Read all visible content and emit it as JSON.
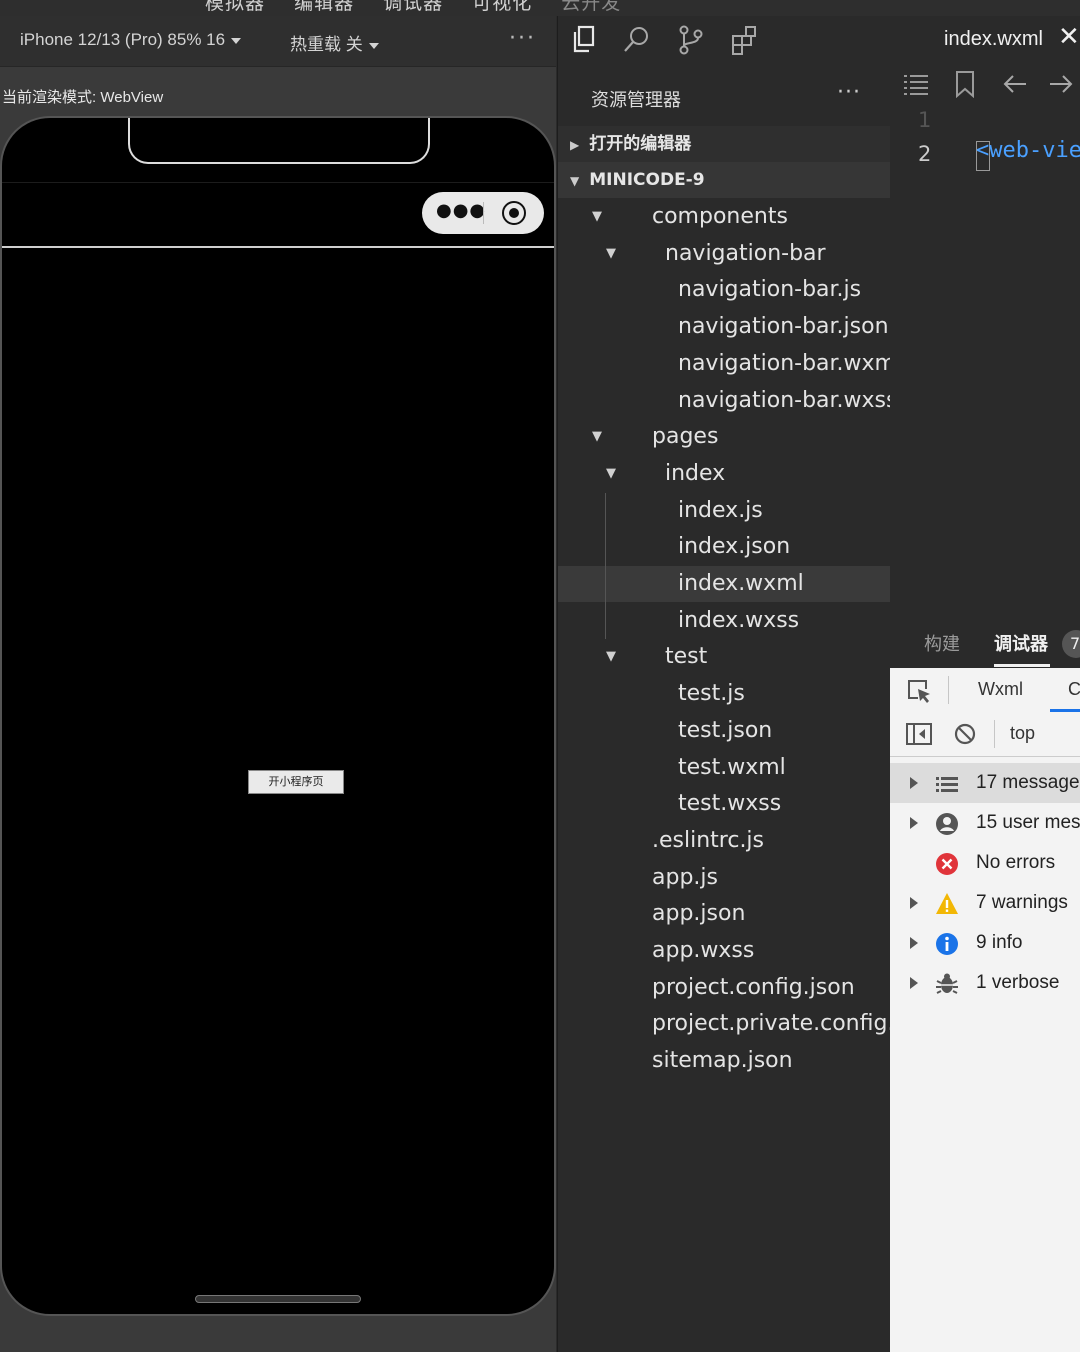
{
  "topbar": {
    "tabs": [
      "模拟器",
      "编辑器",
      "调试器",
      "可视化",
      "云开发"
    ]
  },
  "simulator": {
    "device_select": "iPhone 12/13 (Pro) 85% 16",
    "hot_reload": "热重载 关",
    "more": "···",
    "render_mode": "当前渲染模式: WebView",
    "open_button": "开小程序页"
  },
  "explorer": {
    "title": "资源管理器",
    "more": "···",
    "open_editors": "打开的编辑器",
    "project": "MINICODE-9",
    "tree": [
      {
        "label": "components",
        "twisty": "open"
      },
      {
        "label": "navigation-bar",
        "twisty": "open"
      },
      {
        "label": "navigation-bar.js",
        "twisty": ""
      },
      {
        "label": "navigation-bar.json",
        "twisty": ""
      },
      {
        "label": "navigation-bar.wxml",
        "twisty": ""
      },
      {
        "label": "navigation-bar.wxss",
        "twisty": ""
      },
      {
        "label": "pages",
        "twisty": "open"
      },
      {
        "label": "index",
        "twisty": "open"
      },
      {
        "label": "index.js",
        "twisty": ""
      },
      {
        "label": "index.json",
        "twisty": ""
      },
      {
        "label": "index.wxml",
        "twisty": "",
        "selected": true
      },
      {
        "label": "index.wxss",
        "twisty": ""
      },
      {
        "label": "test",
        "twisty": "open"
      },
      {
        "label": "test.js",
        "twisty": ""
      },
      {
        "label": "test.json",
        "twisty": ""
      },
      {
        "label": "test.wxml",
        "twisty": ""
      },
      {
        "label": "test.wxss",
        "twisty": ""
      },
      {
        "label": ".eslintrc.js",
        "twisty": ""
      },
      {
        "label": "app.js",
        "twisty": ""
      },
      {
        "label": "app.json",
        "twisty": ""
      },
      {
        "label": "app.wxss",
        "twisty": ""
      },
      {
        "label": "project.config.json",
        "twisty": ""
      },
      {
        "label": "project.private.config...",
        "twisty": ""
      },
      {
        "label": "sitemap.json",
        "twisty": ""
      }
    ]
  },
  "editor": {
    "tab_label": "index.wxml",
    "close": "✕",
    "line_numbers": [
      "1",
      "2"
    ],
    "code_line_2": "<web-vie"
  },
  "debugger": {
    "tabs": [
      "构建",
      "调试器"
    ],
    "badge": "7",
    "panel_tabs": [
      "Wxml",
      "C"
    ],
    "context": "top",
    "console_rows": [
      {
        "icon": "list-icon",
        "text": "17 message",
        "expandable": true
      },
      {
        "icon": "user-icon",
        "text": "15 user mes",
        "expandable": true
      },
      {
        "icon": "error-icon",
        "text": "No errors",
        "expandable": false
      },
      {
        "icon": "warning-icon",
        "text": "7 warnings",
        "expandable": true
      },
      {
        "icon": "info-icon",
        "text": "9 info",
        "expandable": true
      },
      {
        "icon": "bug-icon",
        "text": "1 verbose",
        "expandable": true
      }
    ],
    "colors": {
      "error": "#e0343a",
      "warning": "#f2b705",
      "info": "#1a73e8"
    }
  }
}
